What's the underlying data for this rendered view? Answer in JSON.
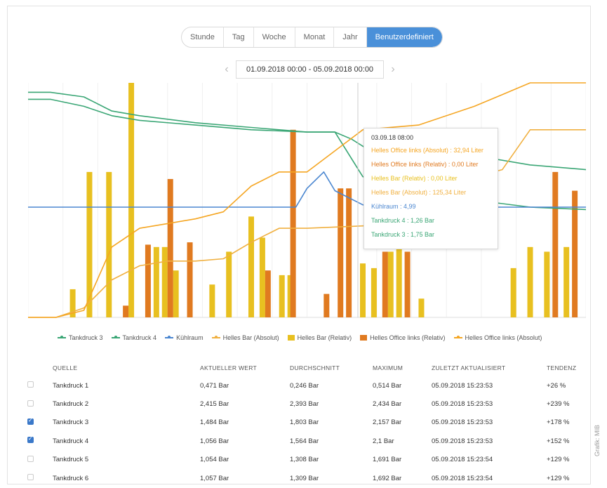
{
  "range_tabs": [
    {
      "label": "Stunde",
      "active": false
    },
    {
      "label": "Tag",
      "active": false
    },
    {
      "label": "Woche",
      "active": false
    },
    {
      "label": "Monat",
      "active": false
    },
    {
      "label": "Jahr",
      "active": false
    },
    {
      "label": "Benutzerdefiniert",
      "active": true
    }
  ],
  "date_range": "01.09.2018 00:00 - 05.09.2018 00:00",
  "colors": {
    "accent": "#4a90d9",
    "tankdruck": "#3aa675",
    "kuehlraum": "#4a86d0",
    "bar_abs": "#f0b040",
    "bar_rel": "#e8c020",
    "office_rel": "#e07a20",
    "office_abs": "#f5a623"
  },
  "tooltip": {
    "title": "03.09.18 08:00",
    "rows": [
      {
        "text": "Helles Office links (Absolut) : 32,94 Liter",
        "color": "#f5a623"
      },
      {
        "text": "Helles Office links (Relativ) : 0,00 Liter",
        "color": "#e07a20"
      },
      {
        "text": "Helles Bar (Relativ) : 0,00 Liter",
        "color": "#e8c020"
      },
      {
        "text": "Helles Bar (Absolut) : 125,34 Liter",
        "color": "#f0b040"
      },
      {
        "text": "Kühlraum : 4,99",
        "color": "#4a86d0"
      },
      {
        "text": "Tankdruck 4 : 1,26 Bar",
        "color": "#3aa675"
      },
      {
        "text": "Tankdruck 3 : 1,75 Bar",
        "color": "#3aa675"
      }
    ]
  },
  "legend": [
    {
      "label": "Tankdruck 3",
      "type": "line",
      "color": "#3aa675"
    },
    {
      "label": "Tankdruck 4",
      "type": "line",
      "color": "#3aa675"
    },
    {
      "label": "Kühlraum",
      "type": "line",
      "color": "#4a86d0"
    },
    {
      "label": "Helles Bar (Absolut)",
      "type": "line",
      "color": "#f0b040"
    },
    {
      "label": "Helles Bar (Relativ)",
      "type": "bar",
      "color": "#e8c020"
    },
    {
      "label": "Helles Office links (Relativ)",
      "type": "bar",
      "color": "#e07a20"
    },
    {
      "label": "Helles Office links (Absolut)",
      "type": "line",
      "color": "#f5a623"
    }
  ],
  "table": {
    "headers": [
      "QUELLE",
      "AKTUELLER WERT",
      "DURCHSCHNITT",
      "MAXIMUM",
      "ZULETZT AKTUALISIERT",
      "TENDENZ"
    ],
    "rows": [
      {
        "checked": false,
        "cells": [
          "Tankdruck 1",
          "0,471 Bar",
          "0,246 Bar",
          "0,514 Bar",
          "05.09.2018 15:23:53",
          "+26 %"
        ]
      },
      {
        "checked": false,
        "cells": [
          "Tankdruck 2",
          "2,415 Bar",
          "2,393 Bar",
          "2,434 Bar",
          "05.09.2018 15:23:53",
          "+239 %"
        ]
      },
      {
        "checked": true,
        "cells": [
          "Tankdruck 3",
          "1,484 Bar",
          "1,803 Bar",
          "2,157 Bar",
          "05.09.2018 15:23:53",
          "+178 %"
        ]
      },
      {
        "checked": true,
        "cells": [
          "Tankdruck 4",
          "1,056 Bar",
          "1,564 Bar",
          "2,1 Bar",
          "05.09.2018 15:23:53",
          "+152 %"
        ]
      },
      {
        "checked": false,
        "cells": [
          "Tankdruck 5",
          "1,054 Bar",
          "1,308 Bar",
          "1,691 Bar",
          "05.09.2018 15:23:54",
          "+129 %"
        ]
      },
      {
        "checked": false,
        "cells": [
          "Tankdruck 6",
          "1,057 Bar",
          "1,309 Bar",
          "1,692 Bar",
          "05.09.2018 15:23:54",
          "+129 %"
        ]
      }
    ]
  },
  "credit": "Grafik: MIB",
  "chart_data": {
    "type": "line",
    "x_range": [
      "01.09.2018 00:00",
      "05.09.2018 00:00"
    ],
    "hover_x": "03.09.18 08:00",
    "grid": true,
    "series": [
      {
        "name": "Tankdruck 3",
        "type": "line",
        "color": "#3aa675",
        "x": [
          0,
          0.04,
          0.1,
          0.15,
          0.2,
          0.3,
          0.4,
          0.5,
          0.55,
          0.6,
          0.7,
          0.8,
          0.9,
          1
        ],
        "y": [
          0.96,
          0.96,
          0.94,
          0.88,
          0.86,
          0.83,
          0.81,
          0.79,
          0.79,
          0.6,
          0.54,
          0.5,
          0.47,
          0.46
        ]
      },
      {
        "name": "Tankdruck 4",
        "type": "line",
        "color": "#3aa675",
        "x": [
          0,
          0.04,
          0.1,
          0.15,
          0.2,
          0.3,
          0.4,
          0.5,
          0.55,
          0.58,
          0.62,
          0.7,
          0.8,
          0.9,
          1
        ],
        "y": [
          0.93,
          0.93,
          0.9,
          0.86,
          0.84,
          0.82,
          0.8,
          0.79,
          0.79,
          0.76,
          0.7,
          0.7,
          0.69,
          0.65,
          0.63
        ]
      },
      {
        "name": "Kühlraum",
        "type": "line",
        "color": "#4a86d0",
        "x": [
          0,
          0.05,
          0.1,
          0.2,
          0.3,
          0.4,
          0.48,
          0.5,
          0.53,
          0.55,
          0.6,
          0.7,
          0.8,
          0.9,
          1
        ],
        "y": [
          0.47,
          0.47,
          0.47,
          0.47,
          0.47,
          0.47,
          0.47,
          0.55,
          0.62,
          0.54,
          0.48,
          0.47,
          0.47,
          0.47,
          0.47
        ]
      },
      {
        "name": "Helles Bar (Absolut)",
        "type": "line",
        "color": "#f0b040",
        "x": [
          0,
          0.05,
          0.1,
          0.15,
          0.2,
          0.25,
          0.3,
          0.35,
          0.4,
          0.45,
          0.5,
          0.6,
          0.7,
          0.8,
          0.85,
          0.9,
          1
        ],
        "y": [
          0,
          0,
          0.04,
          0.16,
          0.22,
          0.24,
          0.24,
          0.25,
          0.32,
          0.38,
          0.38,
          0.39,
          0.4,
          0.6,
          0.63,
          0.8,
          0.8
        ]
      },
      {
        "name": "Helles Office links (Absolut)",
        "type": "line",
        "color": "#f5a623",
        "x": [
          0,
          0.05,
          0.1,
          0.15,
          0.2,
          0.25,
          0.3,
          0.35,
          0.4,
          0.45,
          0.5,
          0.6,
          0.7,
          0.8,
          0.85,
          0.9,
          1
        ],
        "y": [
          0,
          0,
          0.03,
          0.3,
          0.38,
          0.4,
          0.42,
          0.45,
          0.56,
          0.62,
          0.62,
          0.8,
          0.82,
          0.9,
          0.95,
          1,
          1
        ]
      },
      {
        "name": "Helles Bar (Relativ)",
        "type": "bar",
        "color": "#e8c020",
        "x": [
          0.08,
          0.11,
          0.145,
          0.185,
          0.23,
          0.245,
          0.265,
          0.33,
          0.36,
          0.4,
          0.42,
          0.455,
          0.47,
          0.6,
          0.62,
          0.65,
          0.665,
          0.705,
          0.87,
          0.9,
          0.93,
          0.965
        ],
        "y": [
          0.12,
          0.62,
          0.62,
          1.0,
          0.3,
          0.3,
          0.2,
          0.14,
          0.28,
          0.43,
          0.34,
          0.18,
          0.18,
          0.23,
          0.21,
          0.28,
          0.34,
          0.08,
          0.21,
          0.3,
          0.28,
          0.3
        ]
      },
      {
        "name": "Helles Office links (Relativ)",
        "type": "bar",
        "color": "#e07a20",
        "x": [
          0.175,
          0.215,
          0.255,
          0.29,
          0.43,
          0.475,
          0.535,
          0.56,
          0.575,
          0.64,
          0.68,
          0.945,
          0.98
        ],
        "y": [
          0.05,
          0.31,
          0.59,
          0.32,
          0.2,
          0.8,
          0.1,
          0.55,
          0.55,
          0.28,
          0.28,
          0.62,
          0.54
        ]
      }
    ]
  }
}
